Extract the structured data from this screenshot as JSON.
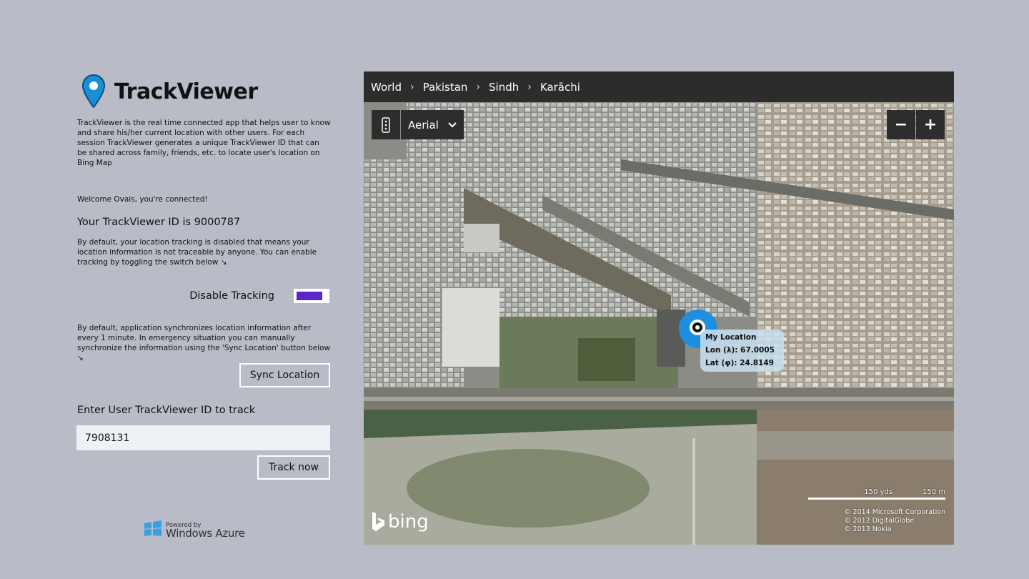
{
  "app": {
    "title": "TrackViewer",
    "description": "TrackViewer is the real time connected app that helps user to know and share his/her current location with other users. For each session TrackViewer generates a unique TrackViewer ID that can be shared across family, friends, etc. to locate user's location on Bing Map"
  },
  "session": {
    "welcome": "Welcome Ovais, you're connected!",
    "id_line": "Your TrackViewer ID is 9000787",
    "tracking_note": "By default, your location tracking is disabled that means your location information is not traceable by anyone. You can enable tracking by toggling the switch below ↘",
    "toggle_label": "Disable Tracking",
    "sync_note": "By default, application synchronizes location information after every 1 minute. In emergency situation you can manually synchronize the information using the 'Sync Location' button below ↘",
    "sync_button": "Sync Location"
  },
  "track": {
    "label": "Enter User TrackViewer ID to track",
    "input_value": "7908131",
    "button": "Track now"
  },
  "footer": {
    "powered_by": "Powered by",
    "brand": "Windows Azure"
  },
  "map": {
    "breadcrumb": [
      "World",
      "Pakistan",
      "Sindh",
      "Karāchi"
    ],
    "map_type": "Aerial",
    "zoom_out": "−",
    "zoom_in": "+",
    "popup": {
      "title": "My Location",
      "lon": "Lon (λ): 67.0005",
      "lat": "Lat (φ): 24.8149"
    },
    "scale": {
      "yds": "150 yds",
      "m": "150 m"
    },
    "copyright": [
      "© 2014 Microsoft Corporation",
      "© 2012 DigitalGlobe",
      "© 2013 Nokia"
    ],
    "bing_logo": "bing"
  },
  "colors": {
    "background": "#b9bcc6",
    "toggle_fill": "#5a26c5",
    "map_bar": "#2c2c2c",
    "location_marker": "#1e8ee0"
  }
}
